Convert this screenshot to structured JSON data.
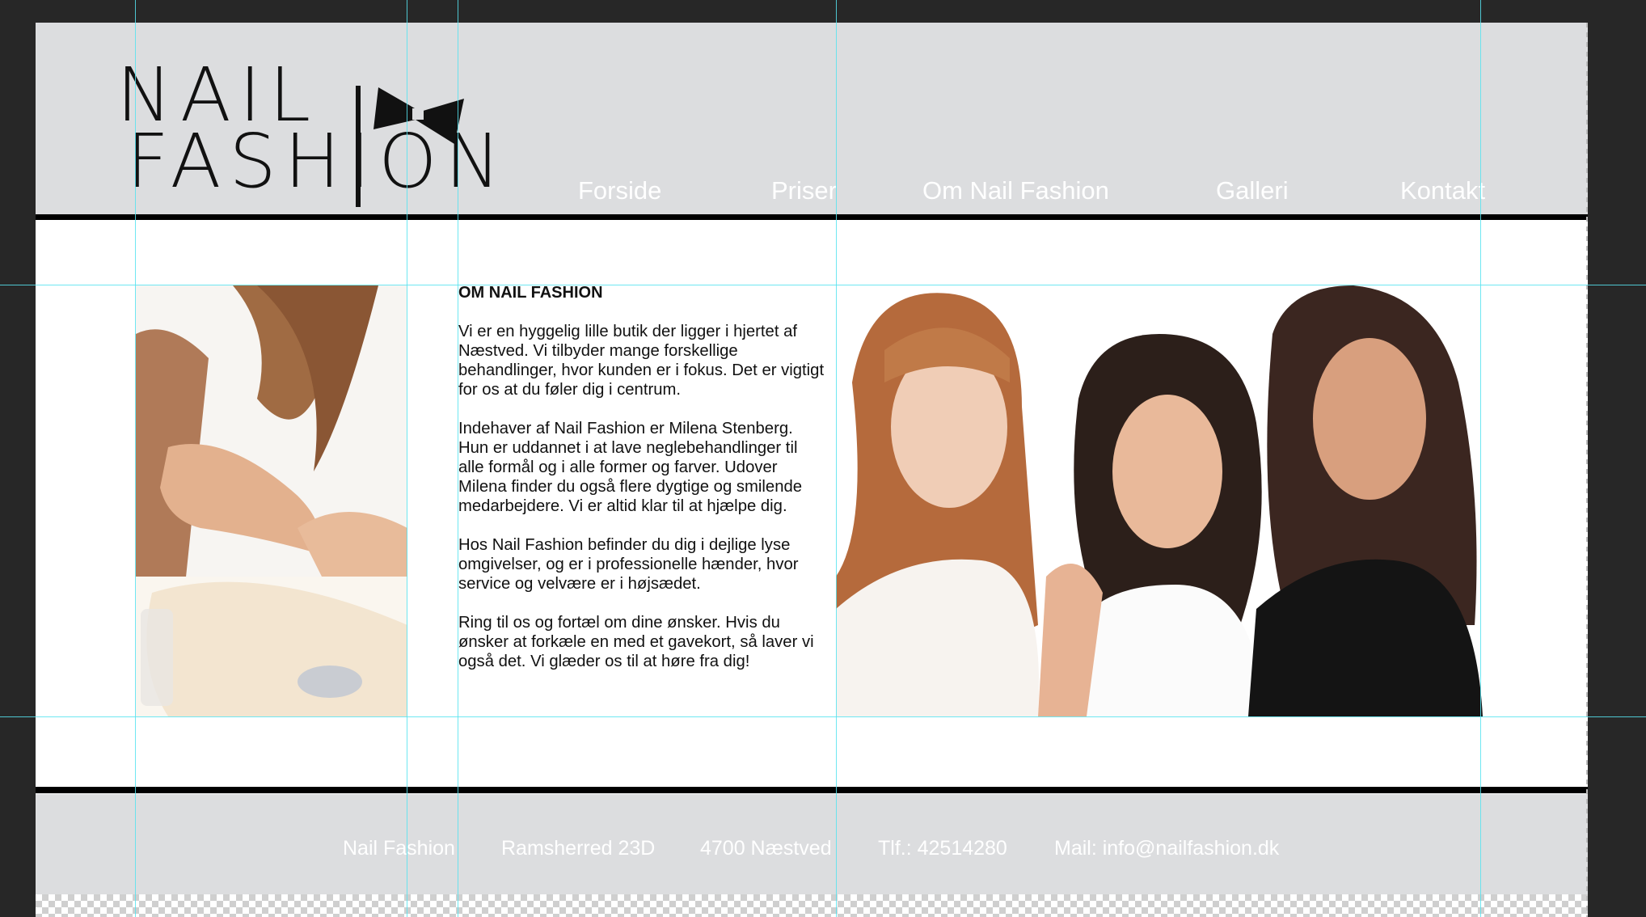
{
  "brand": {
    "logo_line1": "NAIL",
    "logo_line2": "FASHION",
    "accent_color": "#000000",
    "header_bg": "#dcdddf"
  },
  "nav": {
    "items": [
      {
        "label": "Forside"
      },
      {
        "label": "Priser"
      },
      {
        "label": "Om Nail Fashion"
      },
      {
        "label": "Galleri"
      },
      {
        "label": "Kontakt"
      }
    ]
  },
  "main": {
    "title": "OM NAIL FASHION",
    "paragraphs": [
      "Vi er en hyggelig lille butik der ligger i hjertet af Næstved. Vi tilbyder mange forskellige behandlinger, hvor kunden er i fokus. Det er vigtigt for os at du føler dig i centrum.",
      "Indehaver af Nail Fashion er Milena Stenberg. Hun er uddannet i at lave neglebehandlinger til alle formål og i alle former og farver. Udover Milena finder du også flere dygtige og smilende medarbejdere. Vi er altid klar til at hjælpe dig.",
      "Hos Nail Fashion befinder du dig i dejlige lyse omgivelser, og er i professionelle hænder, hvor service og velvære er i højsædet.",
      "Ring til os og fortæl om dine ønsker. Hvis du ønsker at forkæle en med et gavekort, så laver vi også det. Vi glæder os til at høre fra dig!"
    ],
    "left_image": "manicure-photo",
    "right_image": "three-women-photo"
  },
  "footer": {
    "items": [
      {
        "label": "Nail Fashion"
      },
      {
        "label": "Ramsherred 23D"
      },
      {
        "label": "4700 Næstved"
      },
      {
        "label": "Tlf.: 42514280"
      },
      {
        "label": "Mail: info@nailfashion.dk"
      }
    ]
  }
}
